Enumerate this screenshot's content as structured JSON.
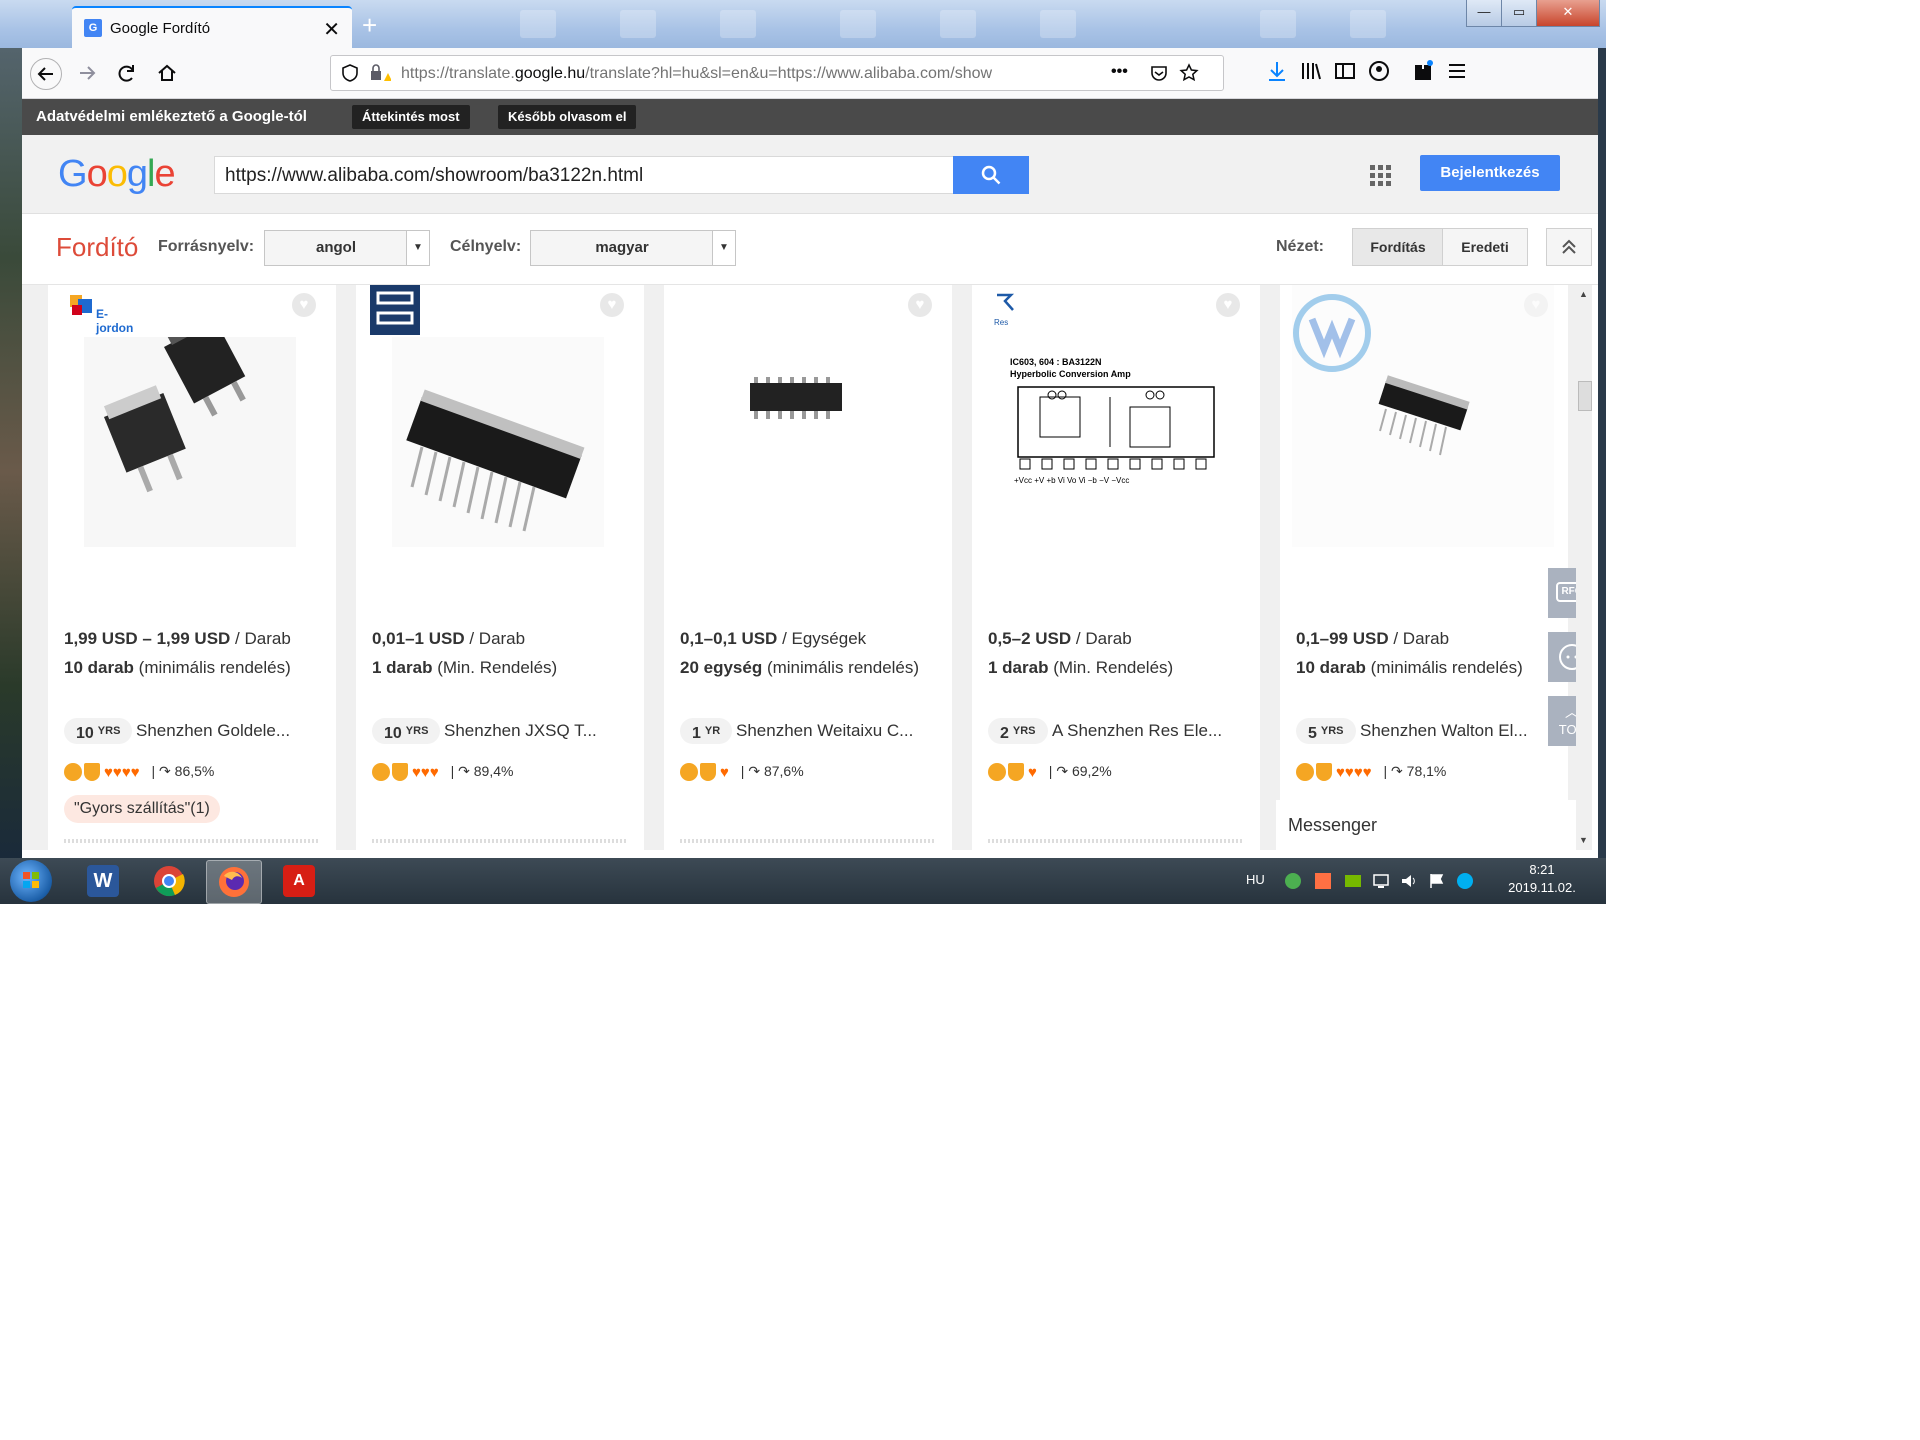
{
  "window": {
    "tab_title": "Google Fordító",
    "tab_close": "✕",
    "new_tab": "+",
    "minimize": "—",
    "maximize": "▭",
    "close": "✕"
  },
  "nav": {
    "url_prefix": "https://translate.",
    "url_domain": "google.hu",
    "url_rest": "/translate?hl=hu&sl=en&u=https://www.alibaba.com/show",
    "more": "•••"
  },
  "privacy_bar": {
    "text": "Adatvédelmi emlékeztető a Google-tól",
    "review_now": "Áttekintés most",
    "read_later": "Később olvasom el"
  },
  "google_header": {
    "logo_letters": [
      "G",
      "o",
      "o",
      "g",
      "l",
      "e"
    ],
    "logo_colors": [
      "#4285f4",
      "#ea4335",
      "#fbbc05",
      "#4285f4",
      "#34a853",
      "#ea4335"
    ],
    "search_value": "https://www.alibaba.com/showroom/ba3122n.html",
    "signin": "Bejelentkezés"
  },
  "translate_bar": {
    "title": "Fordító",
    "source_label": "Forrásnyelv:",
    "source_value": "angol",
    "target_label": "Célnyelv:",
    "target_value": "magyar",
    "view_label": "Nézet:",
    "view_translation": "Fordítás",
    "view_original": "Eredeti"
  },
  "products": [
    {
      "brand": "E-jordon",
      "price_range": "1,99 USD – 1,99 USD",
      "price_unit": " / Darab",
      "moq_value": "10 darab",
      "moq_note": " (minimális rendelés)",
      "years": "10",
      "years_unit": "YRS",
      "supplier": "Shenzhen Goldele...",
      "response": "86,5%",
      "diamonds": "♥♥♥♥",
      "tag": "\"Gyors szállítás\"(1)"
    },
    {
      "brand": "",
      "price_range": "0,01–1 USD",
      "price_unit": " / Darab",
      "moq_value": "1 darab",
      "moq_note": " (Min. Rendelés)",
      "years": "10",
      "years_unit": "YRS",
      "supplier": "Shenzhen JXSQ T...",
      "response": "89,4%",
      "diamonds": "♥♥♥"
    },
    {
      "brand": "",
      "price_range": "0,1–0,1 USD",
      "price_unit": " / Egységek",
      "moq_value": "20 egység",
      "moq_note": " (minimális rendelés)",
      "years": "1",
      "years_unit": "YR",
      "supplier": "Shenzhen Weitaixu C...",
      "response": "87,6%",
      "diamonds": "♥"
    },
    {
      "brand": "Res",
      "price_range": "0,5–2 USD",
      "price_unit": " / Darab",
      "moq_value": "1 darab",
      "moq_note": " (Min. Rendelés)",
      "years": "2",
      "years_unit": "YRS",
      "supplier": "A Shenzhen Res Ele...",
      "response": "69,2%",
      "diamonds": "♥",
      "schematic_title": "IC603, 604 : BA3122N",
      "schematic_subtitle": "Hyperbolic Conversion Amp",
      "schematic_pins": "+Vcc  +V  +b  Vi  Vo  Vi  −b  −V  −Vcc"
    },
    {
      "brand": "",
      "price_range": "0,1–99 USD",
      "price_unit": " / Darab",
      "moq_value": "10 darab",
      "moq_note": " (minimális rendelés)",
      "years": "5",
      "years_unit": "YRS",
      "supplier": "Shenzhen Walton El...",
      "response": "78,1%",
      "diamonds": "♥♥♥♥"
    }
  ],
  "side_buttons": {
    "rfq": "RFQ",
    "top": "TOP"
  },
  "messenger": "Messenger",
  "taskbar": {
    "lang": "HU",
    "time": "8:21",
    "date": "2019.11.02."
  }
}
